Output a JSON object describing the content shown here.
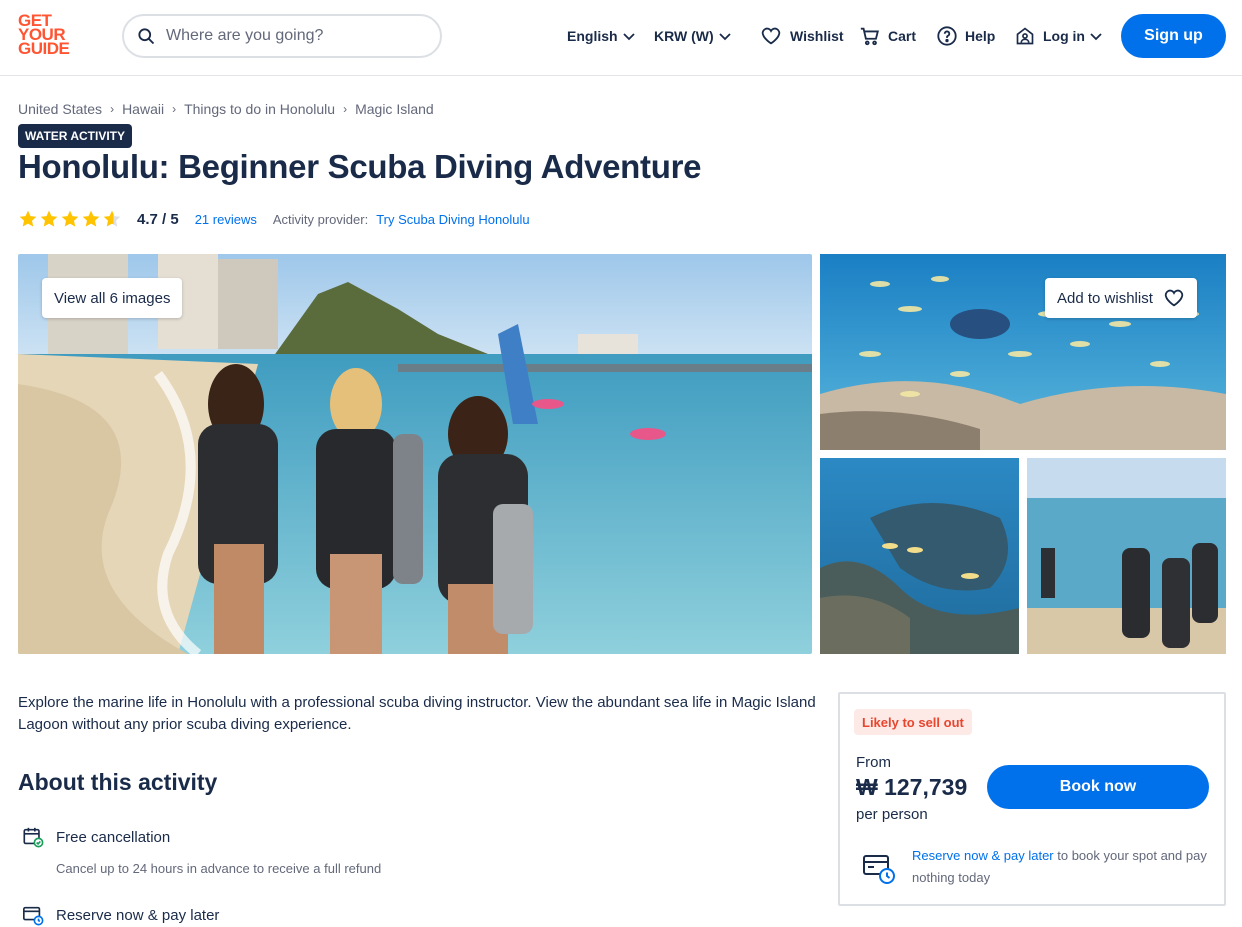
{
  "header": {
    "logo": [
      "GET",
      "YOUR",
      "GUIDE"
    ],
    "search_placeholder": "Where are you going?",
    "language": "English",
    "currency": "KRW (W)",
    "wishlist": "Wishlist",
    "cart": "Cart",
    "help": "Help",
    "login": "Log in",
    "signup": "Sign up"
  },
  "breadcrumb": [
    "United States",
    "Hawaii",
    "Things to do in Honolulu",
    "Magic Island"
  ],
  "badge": "WATER ACTIVITY",
  "title": "Honolulu: Beginner Scuba Diving Adventure",
  "rating": {
    "value": "4.7 / 5",
    "stars": 4.7,
    "reviews": "21 reviews",
    "provider_label": "Activity provider:",
    "provider": "Try Scuba Diving Honolulu"
  },
  "gallery": {
    "view_all": "View all 6 images",
    "add_wishlist": "Add to wishlist"
  },
  "description": "Explore the marine life in Honolulu with a professional scuba diving instructor. View the abundant sea life in Magic Island Lagoon without any prior scuba diving experience.",
  "about": {
    "heading": "About this activity",
    "features": [
      {
        "title": "Free cancellation",
        "sub": "Cancel up to 24 hours in advance to receive a full refund"
      },
      {
        "title": "Reserve now & pay later"
      }
    ]
  },
  "booking": {
    "sellout": "Likely to sell out",
    "from": "From",
    "price": "₩ 127,739",
    "per": "per person",
    "book": "Book now",
    "reserve_link": "Reserve now & pay later",
    "reserve_rest": " to book your spot and pay nothing today"
  },
  "colors": {
    "brand": "#ff5533",
    "primary": "#0071eb",
    "navy": "#1a2b49"
  }
}
